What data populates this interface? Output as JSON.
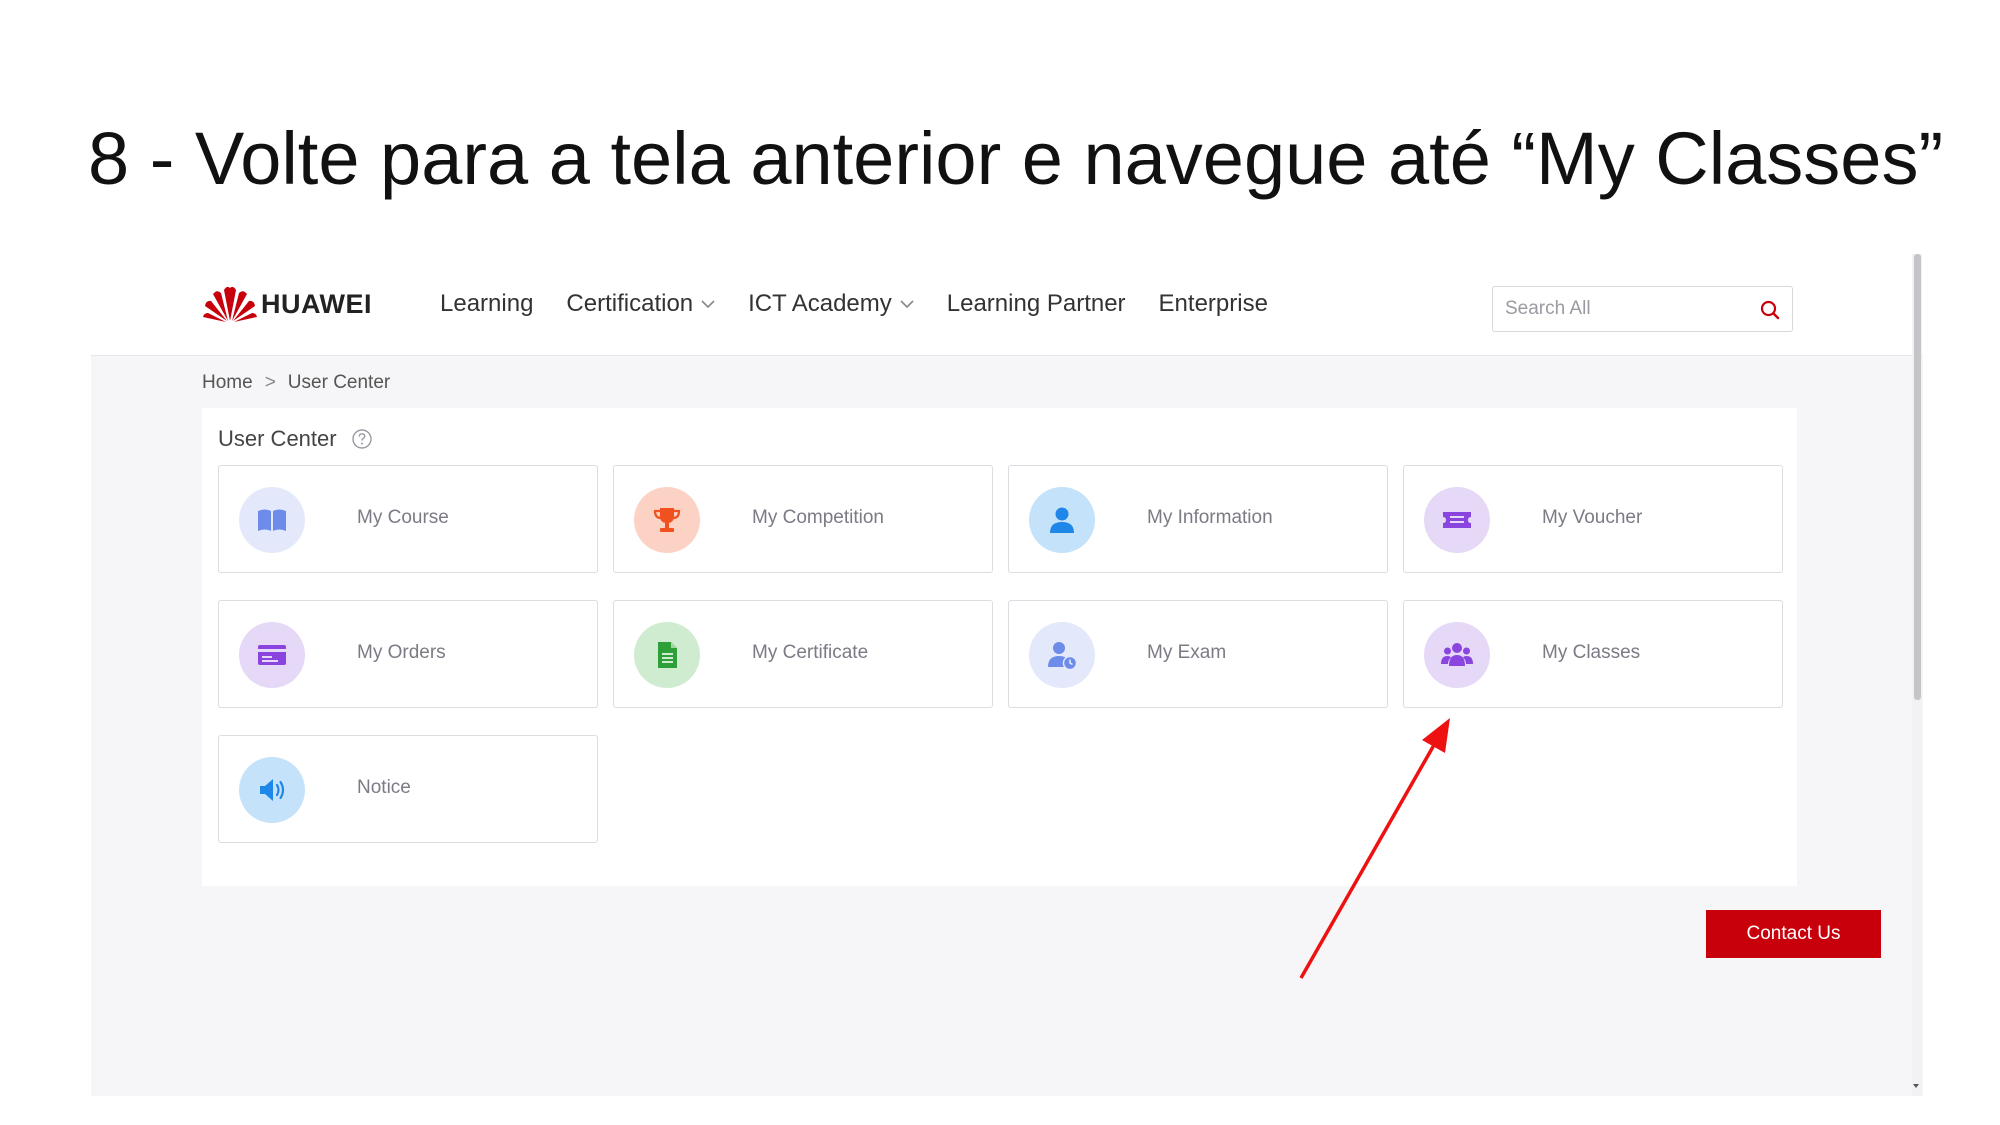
{
  "slide": {
    "title": "8 - Volte para a tela anterior e navegue até “My Classes”"
  },
  "header": {
    "logo_text": "HUAWEI",
    "nav": [
      {
        "label": "Learning",
        "has_dropdown": false
      },
      {
        "label": "Certification",
        "has_dropdown": true
      },
      {
        "label": "ICT Academy",
        "has_dropdown": true
      },
      {
        "label": "Learning Partner",
        "has_dropdown": false
      },
      {
        "label": "Enterprise",
        "has_dropdown": false
      }
    ],
    "search": {
      "placeholder": "Search All",
      "value": "",
      "icon": "search-icon"
    }
  },
  "breadcrumb": {
    "items": [
      "Home",
      "User Center"
    ],
    "separator": ">"
  },
  "user_center": {
    "title": "User Center",
    "cards": [
      {
        "label": "My Course",
        "icon": "book-icon",
        "bg": "#e3e9fb",
        "color": "#6d8be8"
      },
      {
        "label": "My Competition",
        "icon": "trophy-icon",
        "bg": "#fcd2c4",
        "color": "#f0511e"
      },
      {
        "label": "My Information",
        "icon": "user-icon",
        "bg": "#c5e2fb",
        "color": "#1f87e8"
      },
      {
        "label": "My Voucher",
        "icon": "ticket-icon",
        "bg": "#e6d8f7",
        "color": "#8a45de"
      },
      {
        "label": "My Orders",
        "icon": "card-icon",
        "bg": "#e6d8f7",
        "color": "#8a45de"
      },
      {
        "label": "My Certificate",
        "icon": "document-icon",
        "bg": "#cfecd0",
        "color": "#2f9f3a"
      },
      {
        "label": "My Exam",
        "icon": "user-clock-icon",
        "bg": "#e3e9fb",
        "color": "#6d8be8"
      },
      {
        "label": "My Classes",
        "icon": "group-icon",
        "bg": "#e6d8f7",
        "color": "#8a45de"
      },
      {
        "label": "Notice",
        "icon": "speaker-icon",
        "bg": "#c5e2fb",
        "color": "#1f87e8"
      }
    ]
  },
  "contact_button": "Contact Us",
  "colors": {
    "brand_red": "#c7000b",
    "annotation_arrow": "#ee1111"
  }
}
